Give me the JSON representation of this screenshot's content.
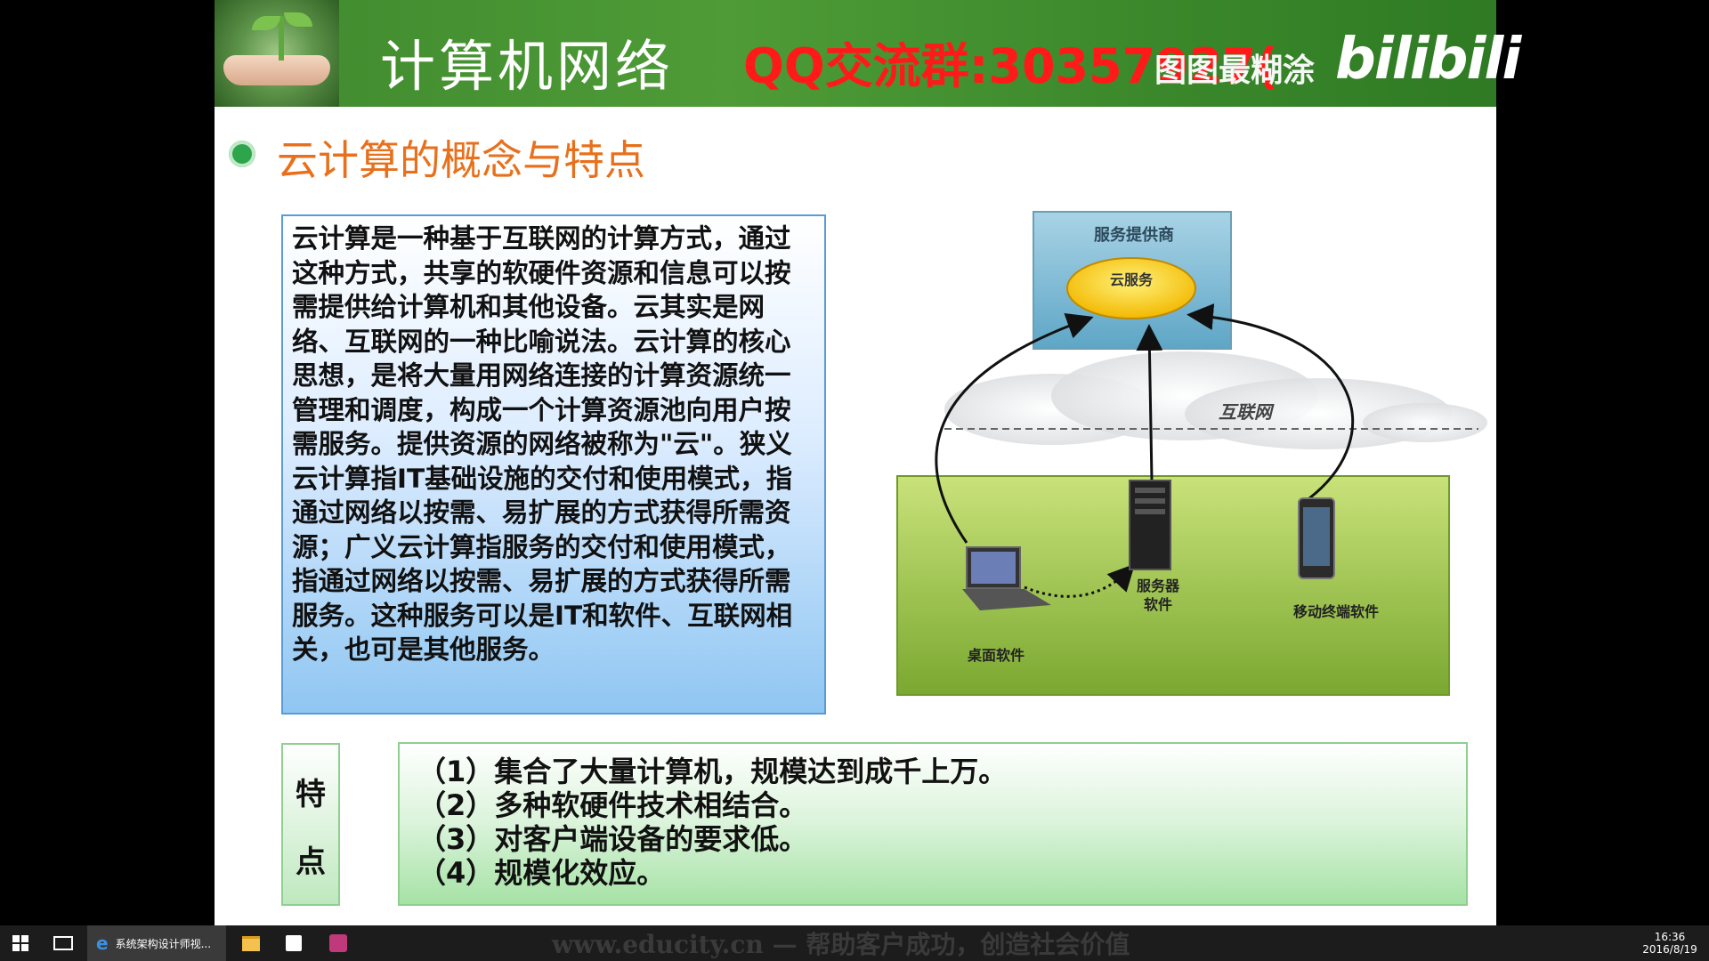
{
  "header": {
    "title": "计算机网络",
    "qq_banner": "QQ交流群:30357927(",
    "watermark": "图图最糊涂",
    "bili_logo": "bilibili"
  },
  "section_title": "云计算的概念与特点",
  "definition_text": "云计算是一种基于互联网的计算方式，通过这种方式，共享的软硬件资源和信息可以按需提供给计算机和其他设备。云其实是网络、互联网的一种比喻说法。云计算的核心思想，是将大量用网络连接的计算资源统一管理和调度，构成一个计算资源池向用户按需服务。提供资源的网络被称为\"云\"。狭义云计算指IT基础设施的交付和使用模式，指通过网络以按需、易扩展的方式获得所需资源；广义云计算指服务的交付和使用模式，指通过网络以按需、易扩展的方式获得所需服务。这种服务可以是IT和软件、互联网相关，也可是其他服务。",
  "diagram": {
    "provider_label": "服务提供商",
    "cloud_service_label": "云服务",
    "internet_label": "互联网",
    "server_label_1": "服务器",
    "server_label_2": "软件",
    "mobile_label": "移动终端软件",
    "desktop_label": "桌面软件"
  },
  "features": {
    "label_1": "特",
    "label_2": "点",
    "items": [
      "（1）集合了大量计算机，规模达到成千上万。",
      "（2）多种软硬件技术相结合。",
      "（3）对客户端设备的要求低。",
      "（4）规模化效应。"
    ]
  },
  "footer": {
    "url": "www.educity.cn — 帮助客户成功，创造社会价值"
  },
  "taskbar": {
    "ie_window_title": "系统架构设计师视...",
    "time": "16:36",
    "date": "2016/8/19"
  },
  "colors": {
    "header_green": "#3f8a2e",
    "qq_red": "#ff1a1a",
    "section_orange": "#e8701c",
    "textbox_blue": "#8fc6f2",
    "feature_green": "#a6e2a6",
    "ground_green": "#8ab83e"
  },
  "icons": [
    "windows-start-icon",
    "task-view-icon",
    "ie-icon",
    "file-explorer-icon",
    "store-icon",
    "app-icon",
    "gear-bullet-icon"
  ]
}
